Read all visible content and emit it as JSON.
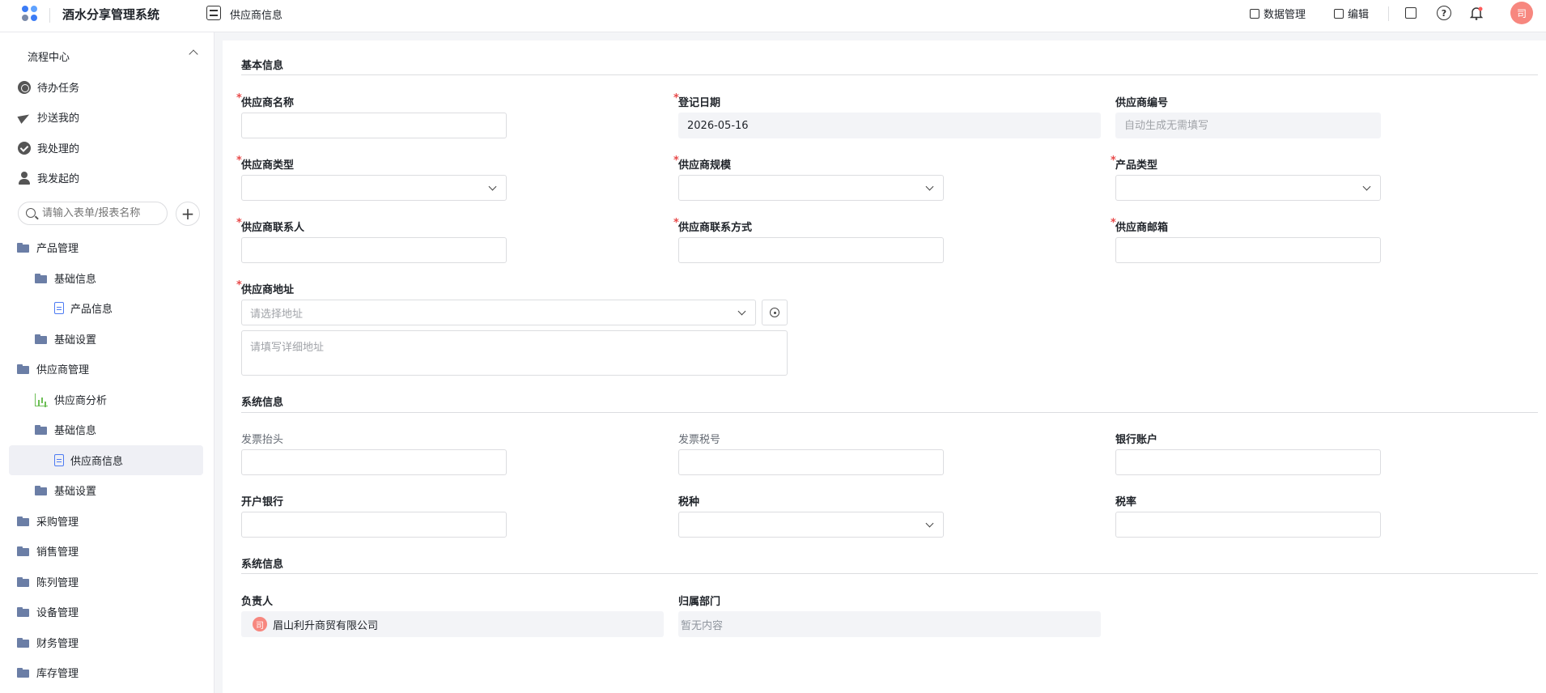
{
  "app": {
    "title": "酒水分享管理系统",
    "page_title": "供应商信息",
    "logo_colors": [
      "#3b7cf6",
      "#5fa2ff",
      "#7a8aa8",
      "#3b7cf6"
    ],
    "accent_color": "#4d7bf3"
  },
  "header": {
    "data_manage": "数据管理",
    "edit": "编辑",
    "help_glyph": "?",
    "avatar_text": "司"
  },
  "sidebar": {
    "flow_center": "流程中心",
    "flow_items": [
      "待办任务",
      "抄送我的",
      "我处理的",
      "我发起的"
    ],
    "search_placeholder": "请输入表单/报表名称",
    "add_glyph": "+",
    "tree": [
      "产品管理",
      "基础信息",
      "产品信息",
      "基础设置",
      "供应商管理",
      "供应商分析",
      "基础信息",
      "供应商信息",
      "基础设置",
      "采购管理",
      "销售管理",
      "陈列管理",
      "设备管理",
      "财务管理",
      "库存管理"
    ]
  },
  "form": {
    "section_basic": "基本信息",
    "supplier_name": "供应商名称",
    "register_date": "登记日期",
    "register_date_value": "2026-05-16",
    "supplier_code": "供应商编号",
    "supplier_code_placeholder": "自动生成无需填写",
    "supplier_type": "供应商类型",
    "supplier_scale": "供应商规模",
    "product_type": "产品类型",
    "contact": "供应商联系人",
    "contact_method": "供应商联系方式",
    "email": "供应商邮箱",
    "address": "供应商地址",
    "address_placeholder": "请选择地址",
    "address_detail_placeholder": "请填写详细地址",
    "section_system": "系统信息",
    "invoice_title": "发票抬头",
    "tax_number": "发票税号",
    "bank_account": "银行账户",
    "bank_name": "开户银行",
    "tax_type": "税种",
    "tax_rate": "税率",
    "section_system2": "系统信息",
    "owner": "负责人",
    "owner_value": "眉山利升商贸有限公司",
    "owner_avatar": "司",
    "department": "归属部门",
    "department_value": "暂无内容",
    "required_mark": "*"
  }
}
